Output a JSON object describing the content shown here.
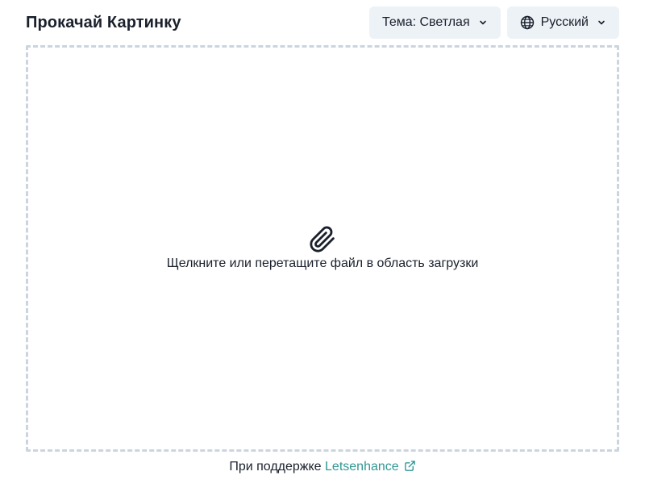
{
  "header": {
    "title": "Прокачай Картинку",
    "theme_label": "Тема: Светлая",
    "language_label": "Русский"
  },
  "dropzone": {
    "hint": "Щелкните или перетащите файл в область загрузки",
    "icon": "paperclip-icon"
  },
  "footer": {
    "powered_by": "При поддержке",
    "link_label": "Letsenhance",
    "link_icon": "external-link-icon"
  },
  "colors": {
    "button_bg": "#edf2f7",
    "dropzone_border": "#cbd5e0",
    "link": "#319795",
    "text": "#1a202c"
  }
}
